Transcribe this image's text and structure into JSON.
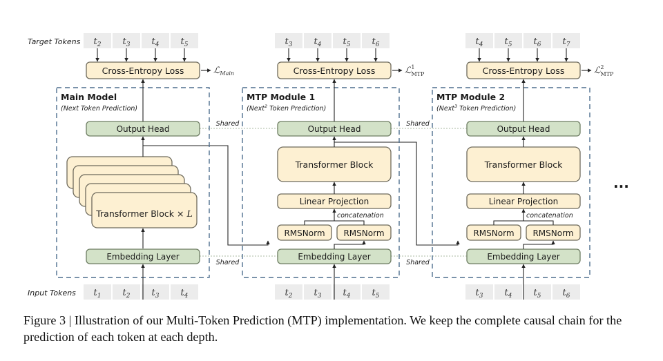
{
  "labels": {
    "target_tokens": "Target Tokens",
    "input_tokens": "Input Tokens",
    "shared": "Shared",
    "concatenation": "concatenation",
    "ellipsis": "..."
  },
  "modules": [
    {
      "title": "Main Model",
      "subtitle_pre": "(Next",
      "subtitle_sup": "",
      "subtitle_post": " Token Prediction)",
      "loss_label": "Cross-Entropy Loss",
      "loss_symbol": "ℒ",
      "loss_sub": "Main",
      "loss_sup": "",
      "output_head": "Output Head",
      "transformer": "Transformer Block × L",
      "embedding": "Embedding Layer",
      "target_tokens": [
        {
          "base": "t",
          "sub": "2"
        },
        {
          "base": "t",
          "sub": "3"
        },
        {
          "base": "t",
          "sub": "4"
        },
        {
          "base": "t",
          "sub": "5"
        }
      ],
      "input_tokens": [
        {
          "base": "t",
          "sub": "1"
        },
        {
          "base": "t",
          "sub": "2"
        },
        {
          "base": "t",
          "sub": "3"
        },
        {
          "base": "t",
          "sub": "4"
        }
      ]
    },
    {
      "title": "MTP Module 1",
      "subtitle_pre": "(Next",
      "subtitle_sup": "2",
      "subtitle_post": " Token Prediction)",
      "loss_label": "Cross-Entropy Loss",
      "loss_symbol": "ℒ",
      "loss_sub": "MTP",
      "loss_sup": "1",
      "output_head": "Output Head",
      "transformer": "Transformer Block",
      "linear": "Linear Projection",
      "rmsnorm_left": "RMSNorm",
      "rmsnorm_right": "RMSNorm",
      "embedding": "Embedding Layer",
      "target_tokens": [
        {
          "base": "t",
          "sub": "3"
        },
        {
          "base": "t",
          "sub": "4"
        },
        {
          "base": "t",
          "sub": "5"
        },
        {
          "base": "t",
          "sub": "6"
        }
      ],
      "input_tokens": [
        {
          "base": "t",
          "sub": "2"
        },
        {
          "base": "t",
          "sub": "3"
        },
        {
          "base": "t",
          "sub": "4"
        },
        {
          "base": "t",
          "sub": "5"
        }
      ]
    },
    {
      "title": "MTP Module 2",
      "subtitle_pre": "(Next",
      "subtitle_sup": "3",
      "subtitle_post": " Token Prediction)",
      "loss_label": "Cross-Entropy Loss",
      "loss_symbol": "ℒ",
      "loss_sub": "MTP",
      "loss_sup": "2",
      "output_head": "Output Head",
      "transformer": "Transformer Block",
      "linear": "Linear Projection",
      "rmsnorm_left": "RMSNorm",
      "rmsnorm_right": "RMSNorm",
      "embedding": "Embedding Layer",
      "target_tokens": [
        {
          "base": "t",
          "sub": "4"
        },
        {
          "base": "t",
          "sub": "5"
        },
        {
          "base": "t",
          "sub": "6"
        },
        {
          "base": "t",
          "sub": "7"
        }
      ],
      "input_tokens": [
        {
          "base": "t",
          "sub": "3"
        },
        {
          "base": "t",
          "sub": "4"
        },
        {
          "base": "t",
          "sub": "5"
        },
        {
          "base": "t",
          "sub": "6"
        }
      ]
    }
  ],
  "caption": "Figure 3 | Illustration of our Multi-Token Prediction (MTP) implementation.  We keep the complete causal chain for the prediction of each token at each depth.",
  "colors": {
    "green_fill": "#d3e2c8",
    "green_stroke": "#6d7d62",
    "cream_fill": "#fdf0d2",
    "cream_stroke": "#6e6a5c",
    "token_fill": "#ececec",
    "dashed_border": "#4e6e8e",
    "shared_text": "#a7b78c",
    "arrow": "#222222"
  }
}
